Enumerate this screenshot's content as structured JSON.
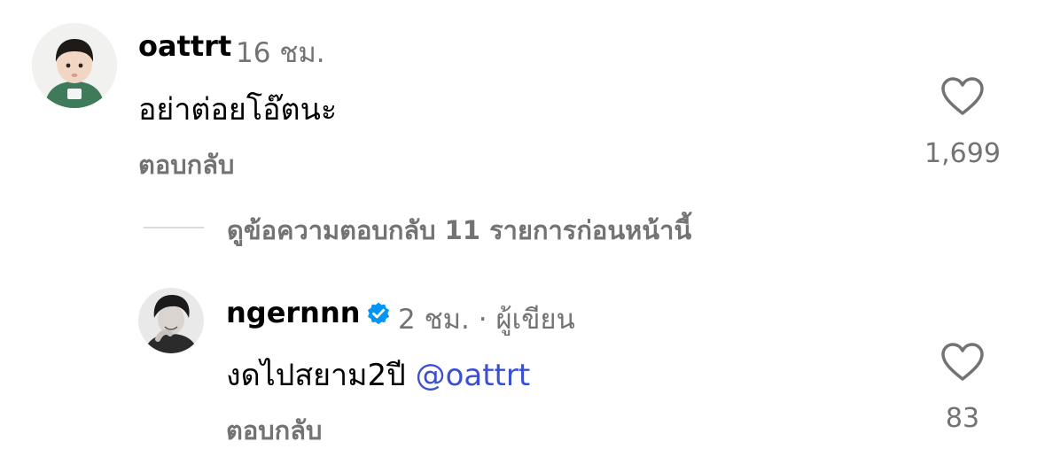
{
  "comments": [
    {
      "username": "oattrt",
      "time": "16 ชม.",
      "text": "อย่าต่อยโอ๊ตนะ",
      "reply_label": "ตอบกลับ",
      "like_count": "1,699",
      "avatar_icon": "child-portrait-avatar",
      "verified": false
    }
  ],
  "view_replies": {
    "label": "ดูข้อความตอบกลับ 11 รายการก่อนหน้านี้"
  },
  "replies": [
    {
      "username": "ngernnn",
      "verified": true,
      "verified_icon": "verified-badge-icon",
      "time": "2 ชม.",
      "separator": "·",
      "role": "ผู้เขียน",
      "text": "งดไปสยาม2ปี",
      "mention": "@oattrt",
      "reply_label": "ตอบกลับ",
      "like_count": "83",
      "avatar_icon": "illustrated-man-avatar"
    }
  ],
  "colors": {
    "secondary_text": "#737373",
    "mention": "#3b4fd1",
    "verified_badge": "#0095f6",
    "divider": "#dbdbdb"
  }
}
